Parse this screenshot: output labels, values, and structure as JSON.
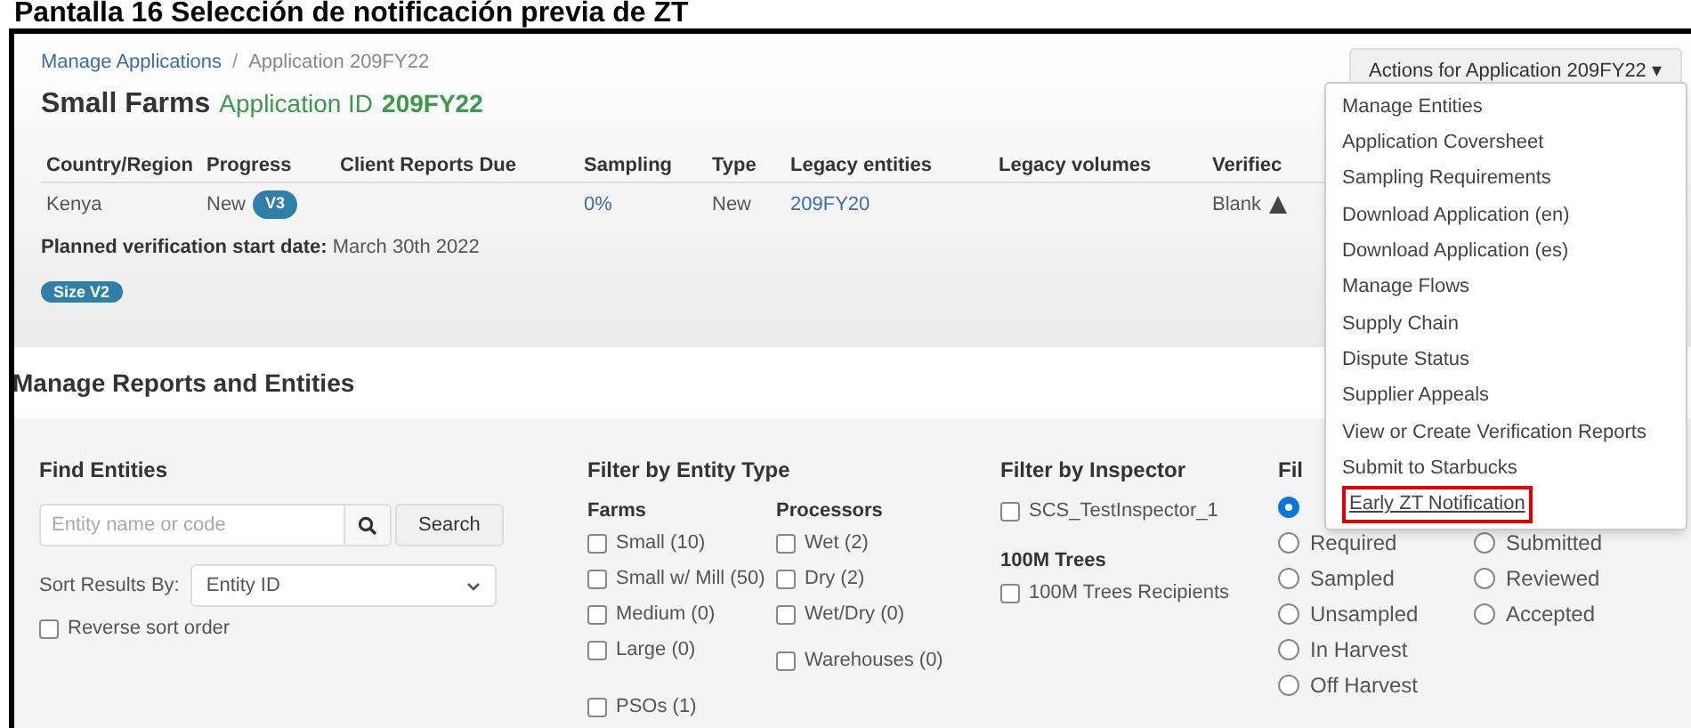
{
  "caption": "Pantalla 16 Selección de notificación previa de ZT",
  "breadcrumb": [
    {
      "label": "Manage Applications",
      "kind": "link"
    },
    {
      "label": "/",
      "kind": "separator"
    },
    {
      "label": "Application 209FY22",
      "kind": "current"
    }
  ],
  "actions_button": {
    "label": "Actions for Application 209FY22",
    "caret": "▾"
  },
  "title": {
    "name": "Small Farms",
    "id_label": "Application ID",
    "id": "209FY22"
  },
  "summary_table": {
    "columns": [
      "Country/Region",
      "Progress",
      "Client Reports Due",
      "Sampling",
      "Type",
      "Legacy entities",
      "Legacy volumes",
      "Verifiec"
    ],
    "row": [
      {
        "kind": "text",
        "text": "Kenya"
      },
      {
        "kind": "badge",
        "text": "New",
        "badge": "V3"
      },
      {
        "kind": "empty"
      },
      {
        "kind": "link",
        "text": "0%"
      },
      {
        "kind": "text",
        "text": "New"
      },
      {
        "kind": "link",
        "text": "209FY20"
      },
      {
        "kind": "empty"
      },
      {
        "kind": "warning",
        "text": "Blank"
      }
    ]
  },
  "planned_start": {
    "label": "Planned verification start date:",
    "value": "March 30th 2022"
  },
  "size_badge": "Size V2",
  "actions_menu": [
    {
      "label": "Manage Entities",
      "selected": false
    },
    {
      "label": "Application Coversheet",
      "selected": false
    },
    {
      "label": "Sampling Requirements",
      "selected": false
    },
    {
      "label": "Download Application (en)",
      "selected": false
    },
    {
      "label": "Download Application (es)",
      "selected": false
    },
    {
      "label": "Manage Flows",
      "selected": false
    },
    {
      "label": "Supply Chain",
      "selected": false
    },
    {
      "label": "Dispute Status",
      "selected": false
    },
    {
      "label": "Supplier Appeals",
      "selected": false
    },
    {
      "label": "View or Create Verification Reports",
      "selected": false
    },
    {
      "label": "Submit to Starbucks",
      "selected": false
    },
    {
      "label": "Early ZT Notification",
      "selected": true
    }
  ],
  "section_title": "Manage Reports and Entities",
  "find": {
    "heading": "Find Entities",
    "placeholder": "Entity name or code",
    "search_button": "Search",
    "sort_label": "Sort Results By:",
    "sort_value": "Entity ID",
    "reverse": {
      "label": "Reverse sort order",
      "checked": false
    }
  },
  "entity_type": {
    "heading": "Filter by Entity Type",
    "groups": [
      {
        "title": "Farms",
        "items": [
          {
            "label": "Small (10)",
            "checked": false
          },
          {
            "label": "Small w/ Mill (50)",
            "checked": false
          },
          {
            "label": "Medium (0)",
            "checked": false
          },
          {
            "label": "Large (0)",
            "checked": false
          }
        ],
        "extra": {
          "label": "PSOs (1)",
          "checked": false
        }
      },
      {
        "title": "Processors",
        "items": [
          {
            "label": "Wet (2)",
            "checked": false
          },
          {
            "label": "Dry (2)",
            "checked": false
          },
          {
            "label": "Wet/Dry (0)",
            "checked": false
          }
        ],
        "extra": {
          "label": "Warehouses (0)",
          "checked": false
        }
      }
    ]
  },
  "inspector": {
    "heading": "Filter by Inspector",
    "items": [
      {
        "label": "SCS_TestInspector_1",
        "checked": false
      }
    ],
    "trees_heading": "100M Trees",
    "trees_items": [
      {
        "label": "100M Trees Recipients",
        "checked": false
      }
    ]
  },
  "status": {
    "heading": "Fil",
    "col1": [
      {
        "selected": true
      },
      {
        "label": "Required",
        "selected": false
      },
      {
        "label": "Sampled",
        "selected": false
      },
      {
        "label": "Unsampled",
        "selected": false
      },
      {
        "label": "In Harvest",
        "selected": false
      },
      {
        "label": "Off Harvest",
        "selected": false
      }
    ],
    "col2": [
      {
        "label": "Submitted",
        "selected": false
      },
      {
        "label": "Reviewed",
        "selected": false
      },
      {
        "label": "Accepted",
        "selected": false
      }
    ]
  }
}
